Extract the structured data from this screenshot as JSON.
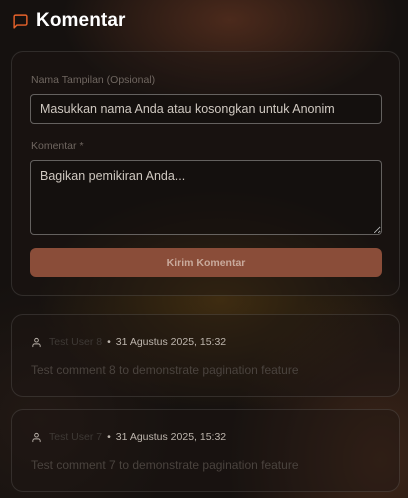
{
  "header": {
    "title": "Komentar",
    "icon": "message-square-icon",
    "accent": "#e8632b"
  },
  "form": {
    "name_label": "Nama Tampilan (Opsional)",
    "name_placeholder": "Masukkan nama Anda atau kosongkan untuk Anonim",
    "name_value": "",
    "comment_label": "Komentar *",
    "comment_placeholder": "Bagikan pemikiran Anda...",
    "comment_value": "",
    "submit_label": "Kirim Komentar",
    "submit_color": "#8a4d39"
  },
  "comments": [
    {
      "author": "Test User 8",
      "separator": "•",
      "timestamp": "31 Agustus 2025, 15:32",
      "text": "Test comment 8 to demonstrate pagination feature"
    },
    {
      "author": "Test User 7",
      "separator": "•",
      "timestamp": "31 Agustus 2025, 15:32",
      "text": "Test comment 7 to demonstrate pagination feature"
    }
  ]
}
